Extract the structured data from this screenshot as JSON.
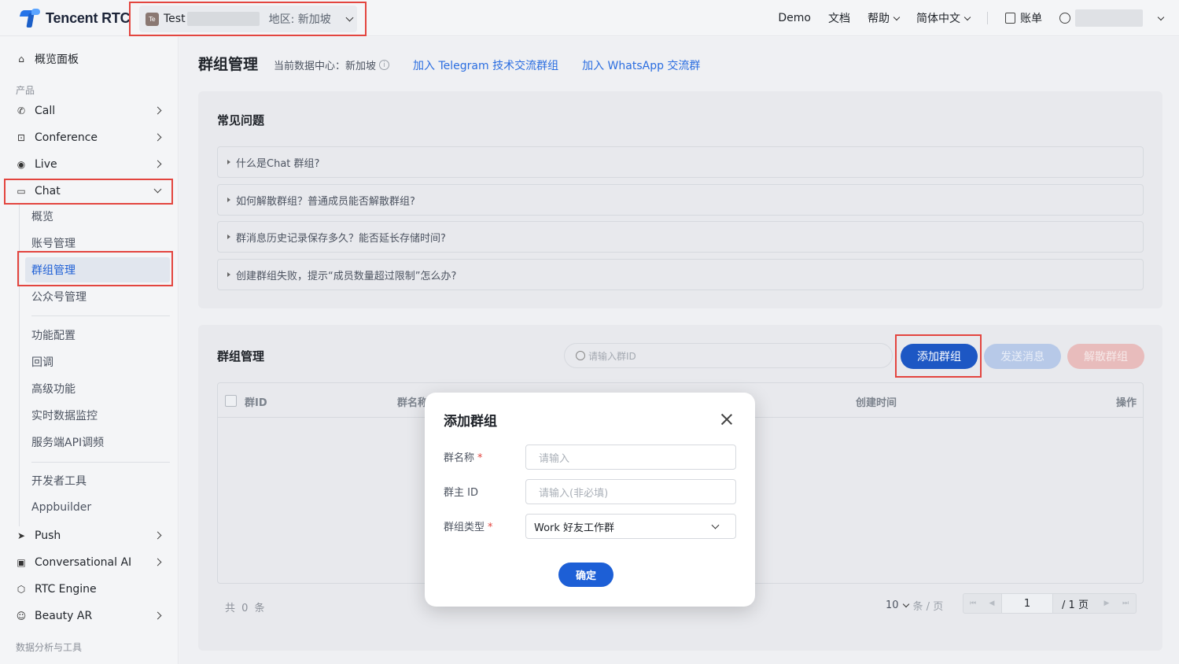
{
  "topbar": {
    "brand": "Tencent RTC",
    "app_badge": "Te",
    "app_name": "Test",
    "region": "地区: 新加坡",
    "nav": [
      "Demo",
      "文档",
      "帮助",
      "简体中文",
      "账单"
    ]
  },
  "sidebar": {
    "overview": "概览面板",
    "group_products": "产品",
    "items": [
      {
        "label": "Call",
        "icon": "phone-icon"
      },
      {
        "label": "Conference",
        "icon": "conference-icon"
      },
      {
        "label": "Live",
        "icon": "live-icon"
      },
      {
        "label": "Chat",
        "icon": "chat-icon"
      }
    ],
    "chat_sub": [
      "概览",
      "账号管理",
      "群组管理",
      "公众号管理"
    ],
    "chat_sub2": [
      "功能配置",
      "回调",
      "高级功能",
      "实时数据监控",
      "服务端API调频"
    ],
    "chat_sub3": [
      "开发者工具",
      "Appbuilder"
    ],
    "items2": [
      {
        "label": "Push",
        "icon": "push-icon"
      },
      {
        "label": "Conversational AI",
        "icon": "ai-icon"
      },
      {
        "label": "RTC Engine",
        "icon": "cube-icon"
      },
      {
        "label": "Beauty AR",
        "icon": "beauty-icon"
      }
    ],
    "group_tools": "数据分析与工具"
  },
  "page": {
    "title": "群组管理",
    "datacenter": "当前数据中心：新加坡",
    "link_telegram": "加入 Telegram 技术交流群组",
    "link_whatsapp": "加入 WhatsApp 交流群"
  },
  "faq": {
    "title": "常见问题",
    "items": [
      "什么是Chat 群组?",
      "如何解散群组？普通成员能否解散群组?",
      "群消息历史记录保存多久？能否延长存储时间?",
      "创建群组失败，提示“成员数量超过限制”怎么办?"
    ]
  },
  "groups": {
    "title": "群组管理",
    "search_placeholder": "请输入群ID",
    "btn_add": "添加群组",
    "btn_send": "发送消息",
    "btn_dismiss": "解散群组",
    "columns": [
      "群ID",
      "群名称",
      "创建时间",
      "操作"
    ],
    "total": "共 0 条",
    "page_size": "10",
    "per_page": "条 / 页",
    "page_current": "1",
    "page_total": "/ 1 页"
  },
  "modal": {
    "title": "添加群组",
    "field_name_label": "群名称",
    "field_name_placeholder": "请输入",
    "field_owner_label": "群主 ID",
    "field_owner_placeholder": "请输入(非必填)",
    "field_type_label": "群组类型",
    "field_type_value": "Work 好友工作群",
    "confirm": "确定"
  },
  "colors": {
    "accent": "#1d57c4",
    "highlight_box": "#e3453f"
  }
}
